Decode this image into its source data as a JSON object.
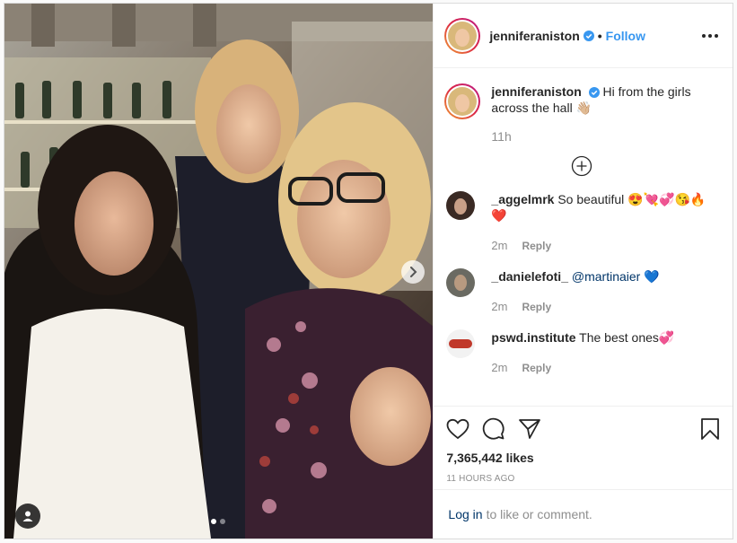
{
  "post": {
    "author": "jenniferaniston",
    "follow_label": "Follow",
    "separator": "•",
    "caption": "Hi from the girls across the hall 👋🏼",
    "caption_age": "11h",
    "likes": "7,365,442 likes",
    "timestamp": "11 HOURS AGO",
    "carousel_index": 1,
    "carousel_count": 2
  },
  "comments": [
    {
      "user": "_aggelmrk",
      "text": "So beautiful 😍💘💞😘🔥❤️",
      "age": "2m",
      "reply_label": "Reply"
    },
    {
      "user": "_danielefoti_",
      "mention": "@martinaier",
      "text": " 💙",
      "age": "2m",
      "reply_label": "Reply"
    },
    {
      "user": "pswd.institute",
      "text": "The best ones💞",
      "age": "2m",
      "reply_label": "Reply"
    }
  ],
  "login": {
    "link_label": "Log in",
    "suffix": "to like or comment."
  },
  "icons": [
    "verified-badge-icon",
    "more-options-icon",
    "load-more-comments-icon",
    "heart-icon",
    "comment-icon",
    "share-icon",
    "bookmark-icon",
    "carousel-next-icon",
    "user-tag-icon"
  ],
  "colors": {
    "accent": "#3897f0",
    "link_dark": "#003569",
    "muted": "#8e8e8e",
    "text": "#262626",
    "border": "#dbdbdb"
  }
}
